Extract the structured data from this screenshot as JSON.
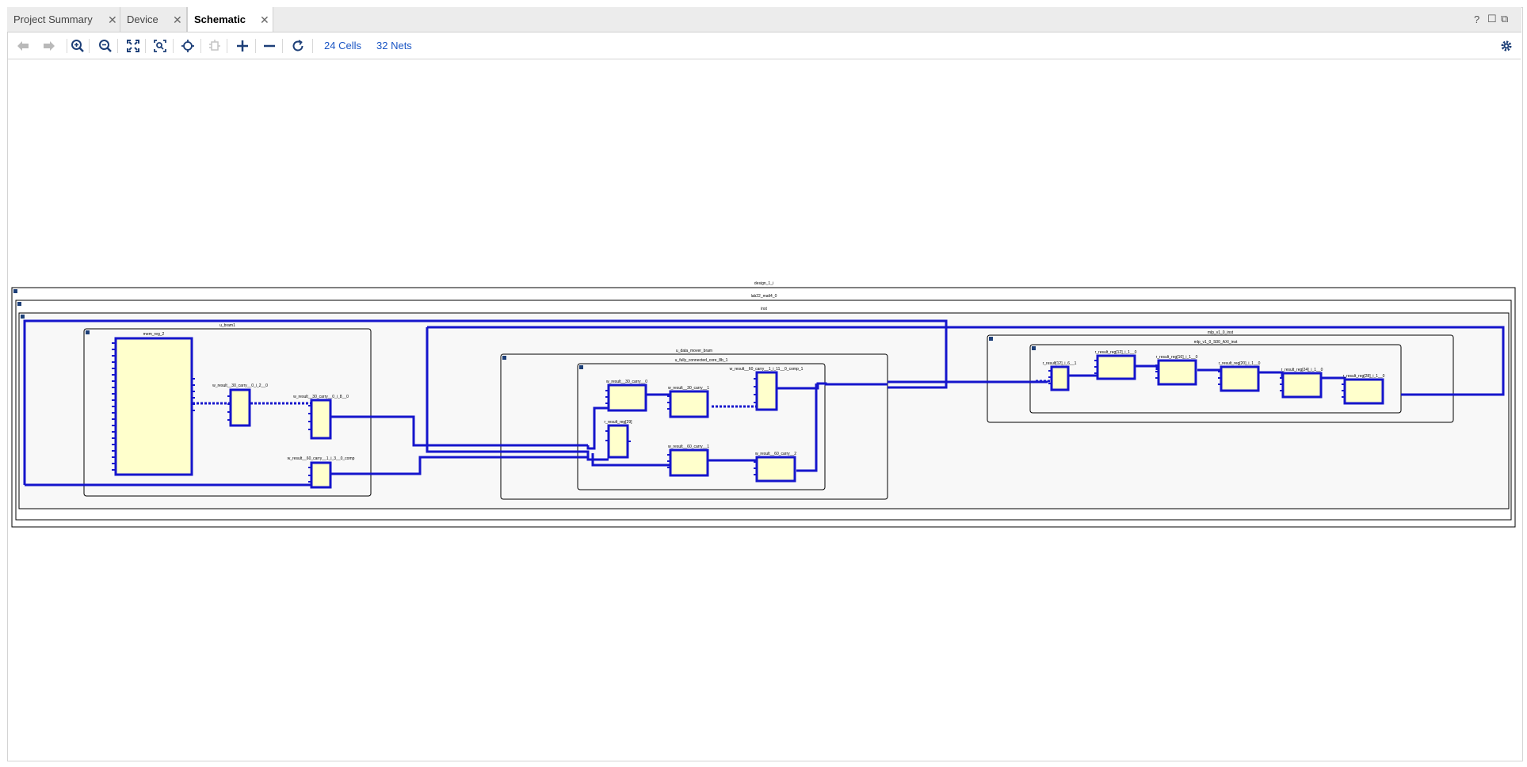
{
  "tabs": [
    {
      "label": "Project Summary",
      "active": false
    },
    {
      "label": "Device",
      "active": false
    },
    {
      "label": "Schematic",
      "active": true
    }
  ],
  "tab_close_glyph": "✕",
  "window_controls": {
    "help": "?",
    "restore": "☐",
    "float": "⧉"
  },
  "toolbar": {
    "buttons": [
      "back-icon",
      "forward-icon",
      "zoom-in-icon",
      "zoom-out-icon",
      "zoom-fit-icon",
      "zoom-area-icon",
      "select-icon",
      "expand-cell-icon",
      "plus-icon",
      "minus-icon",
      "refresh-icon"
    ],
    "cells_label": "24 Cells",
    "nets_label": "32 Nets",
    "settings": "gear-icon"
  },
  "schematic": {
    "design": "design_1_i",
    "module": "lab22_matl4_0",
    "inst": "inst",
    "u_bram1": "u_bram1",
    "mem_reg": "mem_reg_2",
    "bram_c1": "w_result__30_carry__0_i_2__0",
    "bram_c2": "w_result__30_carry__0_i_8__0",
    "bram_c3": "w_result__60_carry__1_i_3__0_comp",
    "dm": "u_data_mover_bram",
    "fc": "u_fully_connected_core_8b_1",
    "fc_c1": "w_result__30_carry__0",
    "fc_c2": "w_result__30_carry__1",
    "fc_c3": "w_result__60_carry__1_i_11__0_comp_1",
    "fc_r": "r_result_reg[29]",
    "fc_c4": "w_result__60_carry__1",
    "fc_c5": "w_result__60_carry__2",
    "mlp": "mlp_v1_0_inst",
    "axi": "mlp_v1_0_S00_AXI_inst",
    "r0": "r_result[12]_i_6__1",
    "r1": "r_result_reg[12]_i_1__0",
    "r2": "r_result_reg[16]_i_1__0",
    "r3": "r_result_reg[20]_i_1__0",
    "r4": "r_result_reg[24]_i_1__0",
    "r5": "r_result_reg[28]_i_1__0"
  },
  "colors": {
    "wire": "#1515cc",
    "cell_fill": "#ffffcc",
    "link": "#1a55c4"
  }
}
